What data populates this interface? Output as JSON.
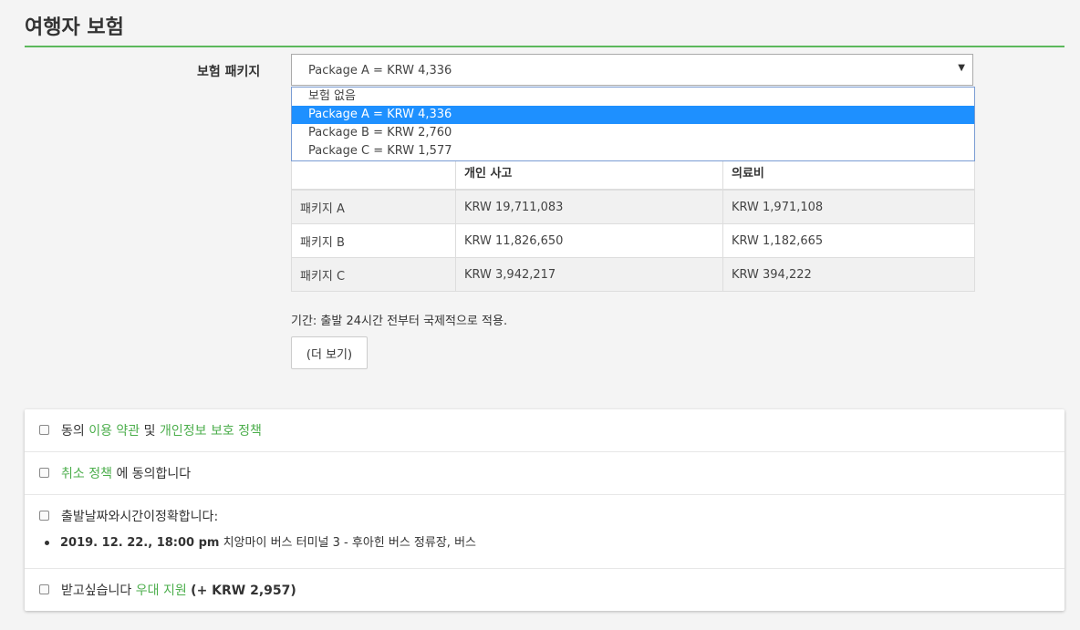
{
  "section_title": "여행자 보험",
  "package": {
    "label": "보험 패키지",
    "selected": "Package A = KRW 4,336",
    "options": [
      "보험 없음",
      "Package A = KRW 4,336",
      "Package B = KRW 2,760",
      "Package C = KRW 1,577"
    ],
    "selected_index": 1
  },
  "coverage_table": {
    "headers": [
      "",
      "개인 사고",
      "의료비"
    ],
    "rows": [
      [
        "패키지 A",
        "KRW 19,711,083",
        "KRW 1,971,108"
      ],
      [
        "패키지 B",
        "KRW 11,826,650",
        "KRW 1,182,665"
      ],
      [
        "패키지 C",
        "KRW 3,942,217",
        "KRW 394,222"
      ]
    ]
  },
  "duration_text": "기간: 출발 24시간 전부터 국제적으로 적용.",
  "more_button": "(더 보기)",
  "agreements": {
    "terms": {
      "prefix": "동의",
      "terms_link": "이용 약관",
      "middle": "및",
      "privacy_link": "개인정보 보호 정책"
    },
    "cancel": {
      "link": "취소 정책",
      "suffix": "에 동의합니다"
    },
    "departure": {
      "text": "출발날짜와시간이정확합니다:",
      "trip_datetime": "2019. 12. 22., 18:00 pm",
      "trip_route": "치앙마이 버스 터미널 3 - 후아힌 버스 정류장, 버스"
    },
    "support": {
      "prefix": "받고싶습니다",
      "link": "우대 지원",
      "price": "(+ KRW 2,957)"
    }
  }
}
